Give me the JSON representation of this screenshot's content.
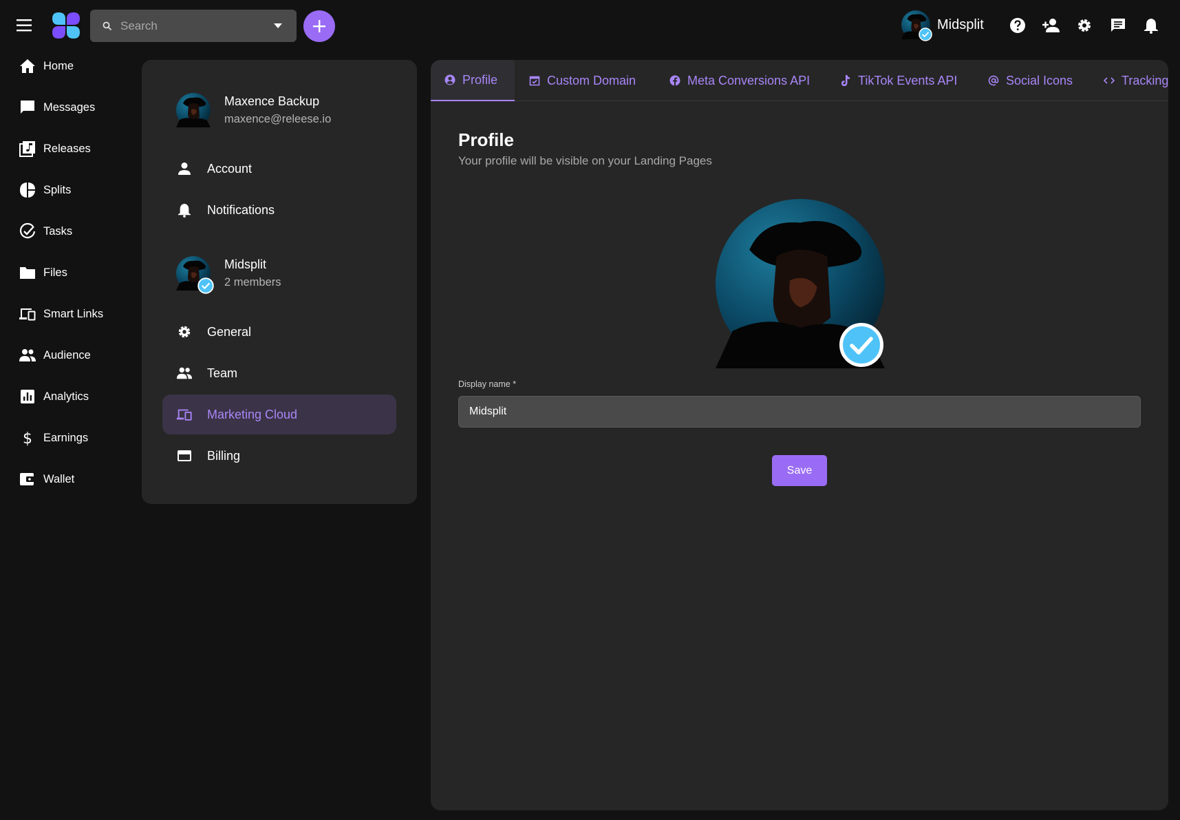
{
  "colors": {
    "accent": "#9a6cf5",
    "accent_text": "#a886f7",
    "verified": "#4fc3f7",
    "background": "#121212",
    "panel": "#262626"
  },
  "search": {
    "placeholder": "Search"
  },
  "user": {
    "name": "Midsplit"
  },
  "topbar_icons": [
    "help-icon",
    "add-user-icon",
    "gear-icon",
    "chat-icon",
    "bell-icon"
  ],
  "nav": {
    "items": [
      {
        "label": "Home",
        "icon": "home-icon"
      },
      {
        "label": "Messages",
        "icon": "messages-icon"
      },
      {
        "label": "Releases",
        "icon": "releases-icon"
      },
      {
        "label": "Splits",
        "icon": "splits-icon"
      },
      {
        "label": "Tasks",
        "icon": "tasks-icon"
      },
      {
        "label": "Files",
        "icon": "folder-icon"
      },
      {
        "label": "Smart Links",
        "icon": "devices-icon"
      },
      {
        "label": "Audience",
        "icon": "people-icon"
      },
      {
        "label": "Analytics",
        "icon": "analytics-icon"
      },
      {
        "label": "Earnings",
        "icon": "dollar-icon"
      },
      {
        "label": "Wallet",
        "icon": "wallet-icon"
      }
    ]
  },
  "settings": {
    "account": {
      "name": "Maxence Backup",
      "email": "maxence@releese.io"
    },
    "account_items": [
      {
        "label": "Account",
        "icon": "person-icon"
      },
      {
        "label": "Notifications",
        "icon": "bell-icon"
      }
    ],
    "team": {
      "name": "Midsplit",
      "members": "2 members"
    },
    "team_items": [
      {
        "label": "General",
        "icon": "gear-icon"
      },
      {
        "label": "Team",
        "icon": "people-icon"
      },
      {
        "label": "Marketing Cloud",
        "icon": "devices-icon",
        "active": true
      },
      {
        "label": "Billing",
        "icon": "credit-card-icon"
      }
    ]
  },
  "tabs": [
    {
      "label": "Profile",
      "icon": "profile-icon",
      "active": true
    },
    {
      "label": "Custom Domain",
      "icon": "calendar-check-icon"
    },
    {
      "label": "Meta Conversions API",
      "icon": "facebook-icon"
    },
    {
      "label": "TikTok Events API",
      "icon": "tiktok-icon"
    },
    {
      "label": "Social Icons",
      "icon": "at-icon"
    },
    {
      "label": "Tracking",
      "icon": "code-icon"
    }
  ],
  "profile": {
    "title": "Profile",
    "subtitle": "Your profile will be visible on your Landing Pages",
    "display_name_label": "Display name *",
    "display_name_value": "Midsplit",
    "save_label": "Save"
  }
}
